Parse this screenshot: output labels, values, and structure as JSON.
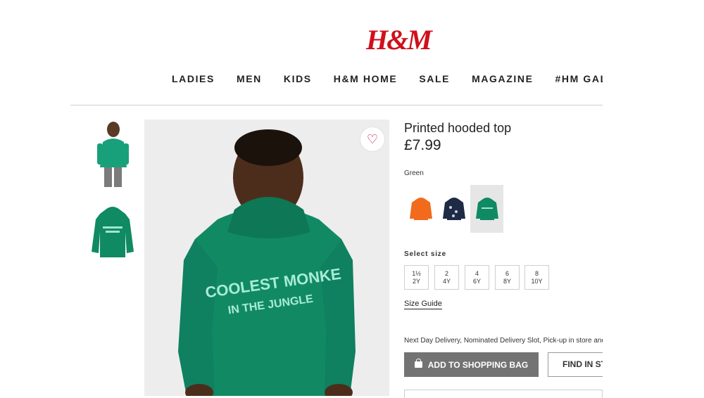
{
  "brand": {
    "logo_text": "H&M",
    "color": "#d0101b"
  },
  "nav": {
    "items": [
      "LADIES",
      "MEN",
      "KIDS",
      "H&M HOME",
      "SALE",
      "MAGAZINE",
      "#HM GALLE"
    ]
  },
  "product": {
    "title": "Printed hooded top",
    "price": "£7.99",
    "color_label": "Green",
    "print_line1": "COOLEST MONKE",
    "print_line2": "IN THE JUNGLE",
    "swatches": [
      {
        "name": "orange",
        "hex": "#f26a1b"
      },
      {
        "name": "navy",
        "hex": "#1f2a44"
      },
      {
        "name": "green",
        "hex": "#0f8a63",
        "selected": true
      }
    ]
  },
  "sizes": {
    "label": "Select size",
    "options": [
      {
        "top": "1½",
        "bottom": "2Y"
      },
      {
        "top": "2",
        "bottom": "4Y"
      },
      {
        "top": "4",
        "bottom": "6Y"
      },
      {
        "top": "6",
        "bottom": "8Y"
      },
      {
        "top": "8",
        "bottom": "10Y"
      }
    ],
    "guide": "Size Guide"
  },
  "delivery_text": "Next Day Delivery, Nominated Delivery Slot, Pick-up in store and",
  "actions": {
    "add_to_bag": "ADD TO SHOPPING BAG",
    "find_in_store": "FIND IN ST"
  },
  "icons": {
    "favorite": "heart-icon",
    "bag": "shopping-bag-icon"
  }
}
